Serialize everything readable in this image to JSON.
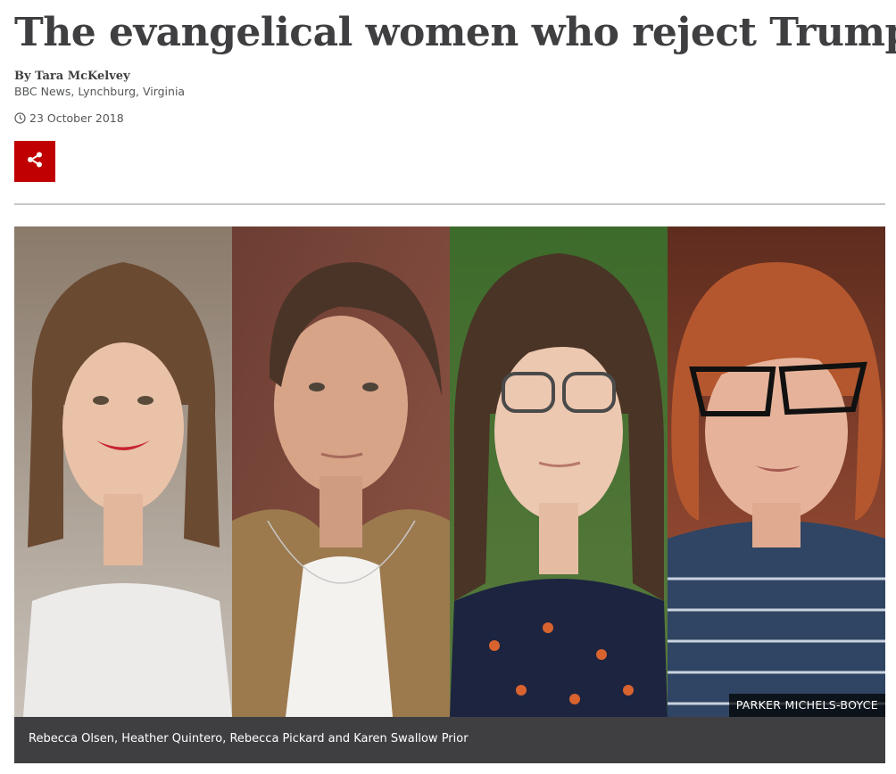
{
  "article": {
    "headline": "The evangelical women who reject Trump",
    "author": "By Tara McKelvey",
    "location": "BBC News, Lynchburg, Virginia",
    "date": "23 October 2018"
  },
  "share": {
    "icon": "share-icon"
  },
  "image": {
    "credit": "PARKER MICHELS-BOYCE",
    "caption": "Rebecca Olsen, Heather Quintero, Rebecca Pickard and Karen Swallow Prior"
  },
  "colors": {
    "text": "#3f3f42",
    "share_bg": "#c00000",
    "caption_bg": "#3f3f42",
    "divider": "#c6c6c6"
  }
}
